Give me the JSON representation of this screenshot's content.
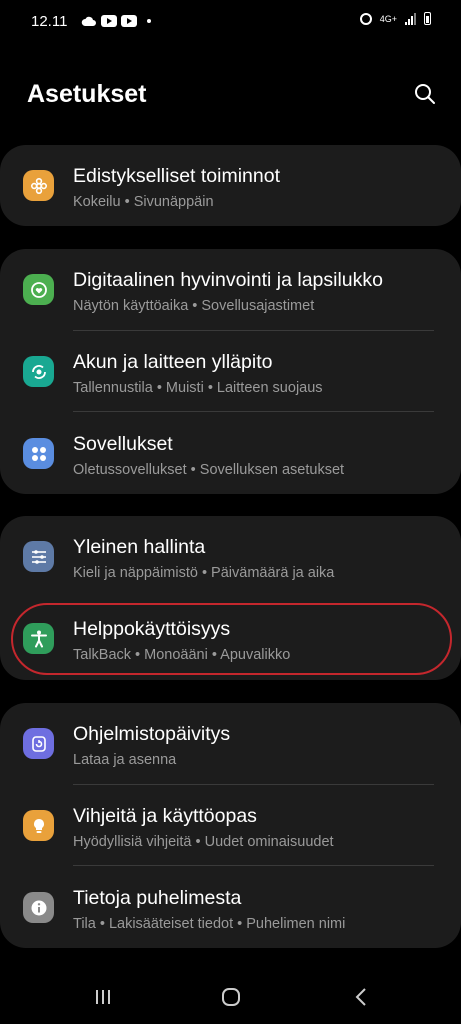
{
  "status_bar": {
    "time": "12.11",
    "network": "4G+",
    "icons": [
      "cloud-icon",
      "youtube-icon",
      "youtube-icon",
      "dot",
      "alarm-icon",
      "signal-icon",
      "battery-icon"
    ]
  },
  "header": {
    "title": "Asetukset",
    "search_icon": "search-icon"
  },
  "groups": [
    {
      "items": [
        {
          "title": "Edistykselliset toiminnot",
          "subtitle": "Kokeilu  •  Sivunäppäin",
          "icon": "flower-icon",
          "color": "#e9a13b"
        }
      ]
    },
    {
      "items": [
        {
          "title": "Digitaalinen hyvinvointi ja lapsilukko",
          "subtitle": "Näytön käyttöaika  •  Sovellusajastimet",
          "icon": "wellbeing-icon",
          "color": "#4caf50"
        },
        {
          "title": "Akun ja laitteen ylläpito",
          "subtitle": "Tallennustila  •  Muisti  •  Laitteen suojaus",
          "icon": "device-care-icon",
          "color": "#19a892"
        },
        {
          "title": "Sovellukset",
          "subtitle": "Oletussovellukset  •  Sovelluksen asetukset",
          "icon": "apps-icon",
          "color": "#5a8de0"
        }
      ]
    },
    {
      "items": [
        {
          "title": "Yleinen hallinta",
          "subtitle": "Kieli ja näppäimistö  •  Päivämäärä ja aika",
          "icon": "sliders-icon",
          "color": "#5e7aa6"
        },
        {
          "title": "Helppokäyttöisyys",
          "subtitle": "TalkBack  •  Monoääni  •  Apuvalikko",
          "icon": "accessibility-icon",
          "color": "#2f9d5b"
        }
      ]
    },
    {
      "items": [
        {
          "title": "Ohjelmistopäivitys",
          "subtitle": "Lataa ja asenna",
          "icon": "software-update-icon",
          "color": "#6e6ee0"
        },
        {
          "title": "Vihjeitä ja käyttöopas",
          "subtitle": "Hyödyllisiä vihjeitä  •  Uudet ominaisuudet",
          "icon": "lightbulb-icon",
          "color": "#e9a13b"
        },
        {
          "title": "Tietoja puhelimesta",
          "subtitle": "Tila  •  Lakisääteiset tiedot  •  Puhelimen nimi",
          "icon": "info-icon",
          "color": "#8a8a8a"
        }
      ]
    }
  ],
  "nav_bar": {
    "recents": "recents-icon",
    "home": "home-icon",
    "back": "back-icon"
  }
}
